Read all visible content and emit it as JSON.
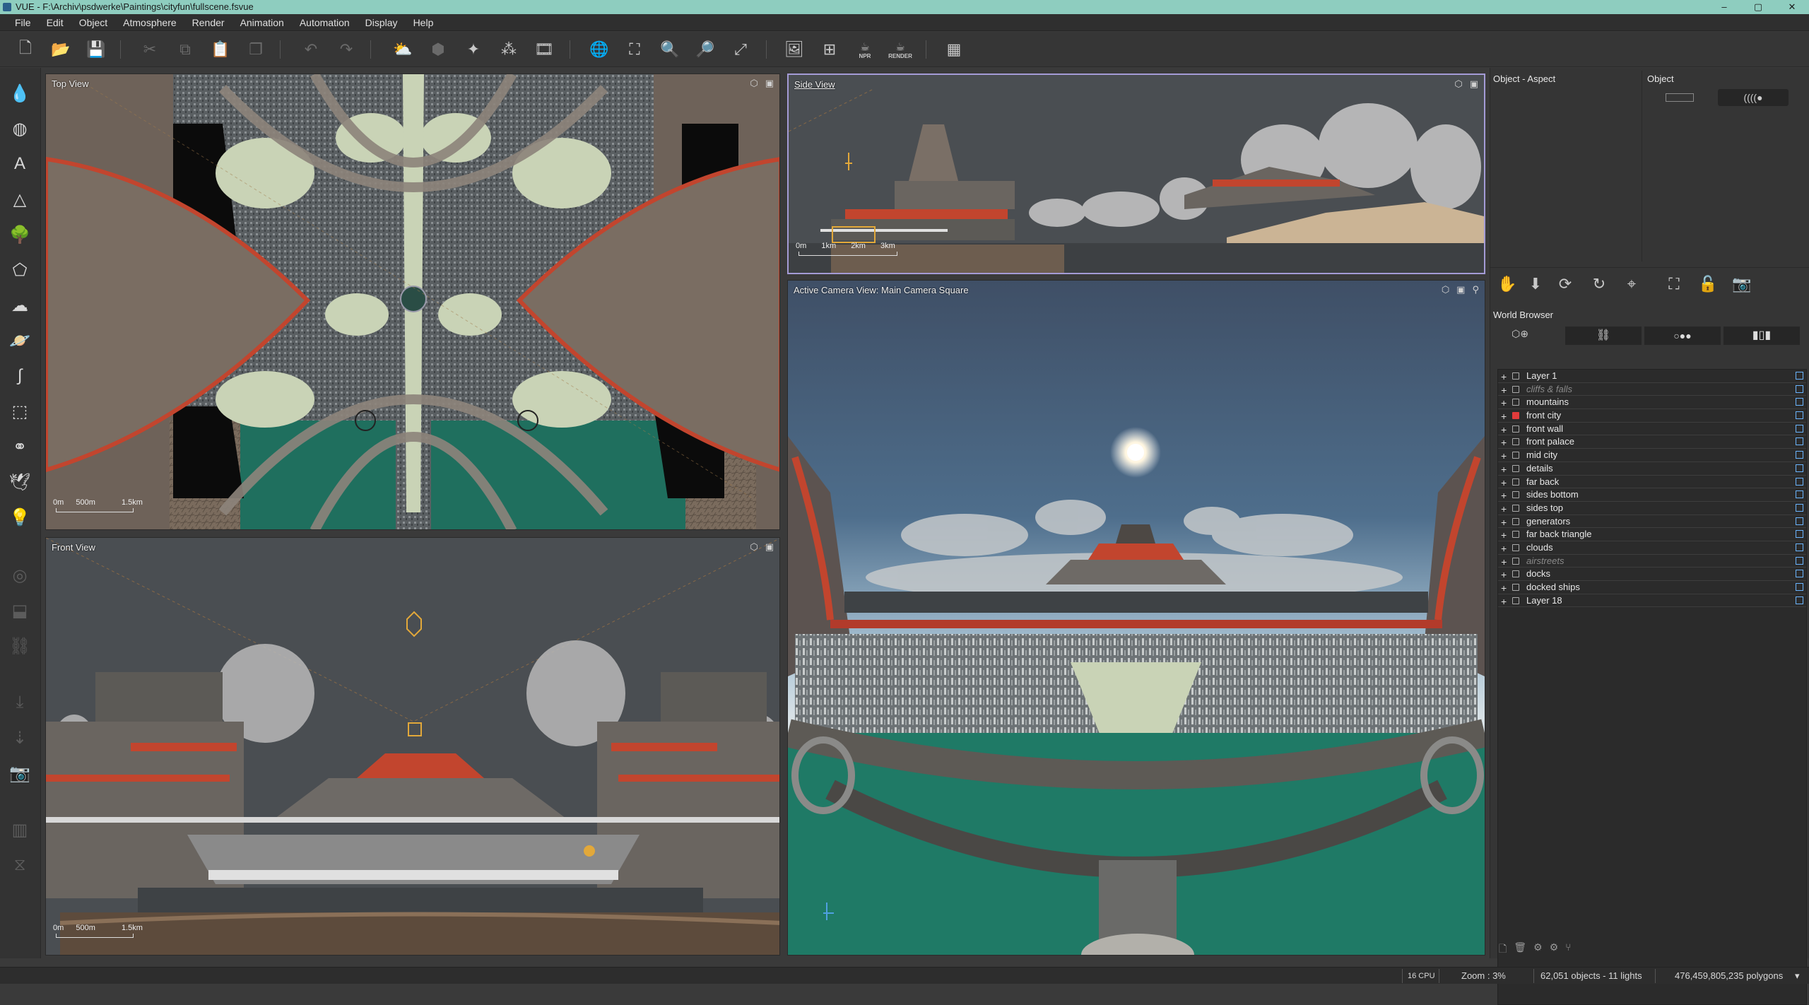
{
  "window": {
    "title": "VUE - F:\\Archiv\\psdwerke\\Paintings\\cityfun\\fullscene.fsvue",
    "controls": [
      "–",
      "▢",
      "✕"
    ]
  },
  "menu": [
    "File",
    "Edit",
    "Object",
    "Atmosphere",
    "Render",
    "Animation",
    "Automation",
    "Display",
    "Help"
  ],
  "toolbar": {
    "npr_label": "NPR",
    "render_label": "RENDER"
  },
  "viewports": {
    "top": {
      "title": "Top View",
      "scale": [
        "0m",
        "500m",
        "1.5km"
      ]
    },
    "side": {
      "title": "Side View",
      "scale": [
        "0m",
        "1km",
        "2km",
        "3km"
      ]
    },
    "front": {
      "title": "Front View",
      "scale": [
        "0m",
        "500m",
        "1.5km"
      ]
    },
    "camera": {
      "title": "Active Camera View: Main Camera Square"
    }
  },
  "object_panel": {
    "aspect_title": "Object - Aspect",
    "object_title": "Object"
  },
  "world_browser": {
    "title": "World Browser",
    "layers": [
      {
        "name": "Layer 1",
        "style": "normal"
      },
      {
        "name": "cliffs & falls",
        "style": "ghost"
      },
      {
        "name": "mountains",
        "style": "normal"
      },
      {
        "name": "front city",
        "style": "red"
      },
      {
        "name": "front wall",
        "style": "normal"
      },
      {
        "name": "front palace",
        "style": "normal"
      },
      {
        "name": "mid city",
        "style": "normal"
      },
      {
        "name": "details",
        "style": "normal"
      },
      {
        "name": "far back",
        "style": "normal"
      },
      {
        "name": "sides bottom",
        "style": "normal"
      },
      {
        "name": "sides top",
        "style": "normal"
      },
      {
        "name": "generators",
        "style": "normal"
      },
      {
        "name": "far back triangle",
        "style": "normal"
      },
      {
        "name": "clouds",
        "style": "normal"
      },
      {
        "name": "airstreets",
        "style": "ghost"
      },
      {
        "name": "docks",
        "style": "normal"
      },
      {
        "name": "docked ships",
        "style": "normal"
      },
      {
        "name": "Layer 18",
        "style": "normal"
      }
    ]
  },
  "status": {
    "cpu": "16 CPU",
    "zoom": "Zoom : 3%",
    "objects": "62,051 objects - 11 lights",
    "polygons": "476,459,805,235 polygons"
  },
  "colors": {
    "titlebar": "#8ecdbf",
    "active_viewport_border": "#a49bd6",
    "red_layer": "#e23b3b",
    "terrain_pale": "#c9d3b6",
    "sea_teal": "#1f7a66"
  }
}
